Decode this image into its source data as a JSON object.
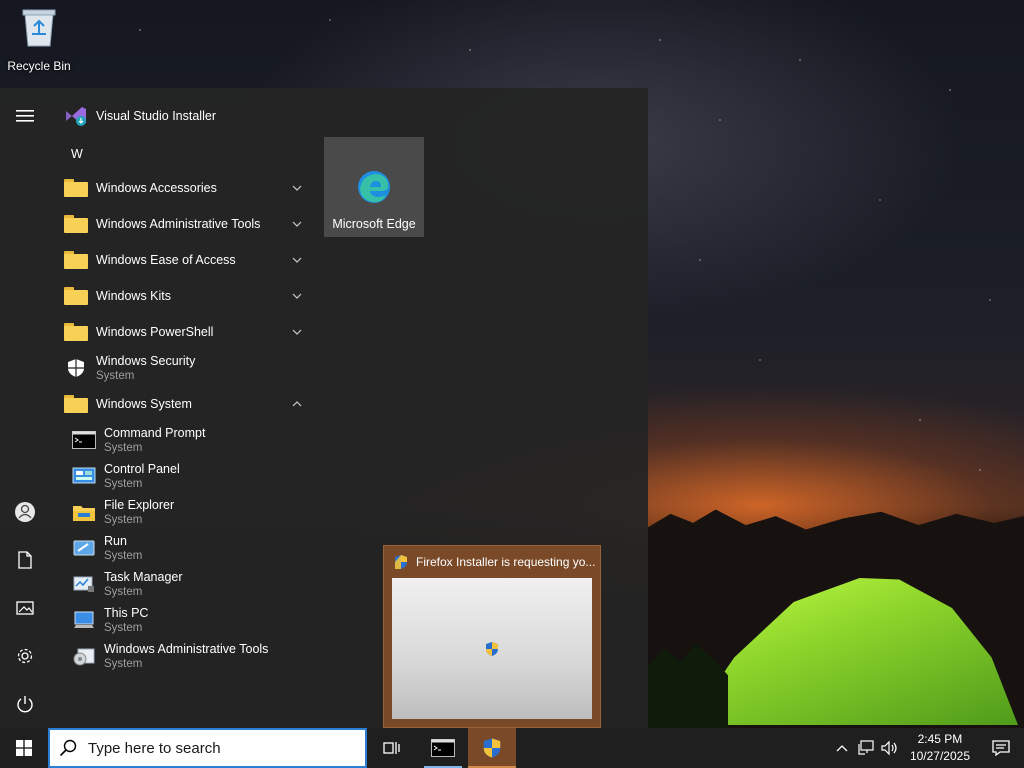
{
  "desktop": {
    "recycle_bin_label": "Recycle Bin"
  },
  "start_menu": {
    "top_item": {
      "label": "Visual Studio Installer"
    },
    "letter_header": "W",
    "folders": [
      {
        "label": "Windows Accessories",
        "expanded": false
      },
      {
        "label": "Windows Administrative Tools",
        "expanded": false
      },
      {
        "label": "Windows Ease of Access",
        "expanded": false
      },
      {
        "label": "Windows Kits",
        "expanded": false
      },
      {
        "label": "Windows PowerShell",
        "expanded": false
      }
    ],
    "security": {
      "label": "Windows Security",
      "sub": "System"
    },
    "system_folder": {
      "label": "Windows System",
      "expanded": true
    },
    "system_apps": [
      {
        "label": "Command Prompt",
        "sub": "System",
        "icon": "cmd-icon"
      },
      {
        "label": "Control Panel",
        "sub": "System",
        "icon": "control-panel-icon"
      },
      {
        "label": "File Explorer",
        "sub": "System",
        "icon": "file-explorer-icon"
      },
      {
        "label": "Run",
        "sub": "System",
        "icon": "run-icon"
      },
      {
        "label": "Task Manager",
        "sub": "System",
        "icon": "task-manager-icon"
      },
      {
        "label": "This PC",
        "sub": "System",
        "icon": "this-pc-icon"
      },
      {
        "label": "Windows Administrative Tools",
        "sub": "System",
        "icon": "admin-tools-icon"
      }
    ],
    "tile": {
      "label": "Microsoft Edge"
    },
    "rail_icons": [
      "hamburger-icon",
      "user-icon",
      "documents-icon",
      "pictures-icon",
      "settings-icon",
      "power-icon"
    ]
  },
  "preview": {
    "title": "Firefox Installer is requesting yo..."
  },
  "taskbar": {
    "search_placeholder": "Type here to search",
    "clock_time": "2:45 PM",
    "clock_date": "10/27/2025"
  },
  "colors": {
    "start_bg": "#242424",
    "taskbar_bg": "#1f1f1f",
    "search_border": "#2a7fd4",
    "uac_highlight": "#7a4a28",
    "folder_yellow": "#f7d055"
  }
}
